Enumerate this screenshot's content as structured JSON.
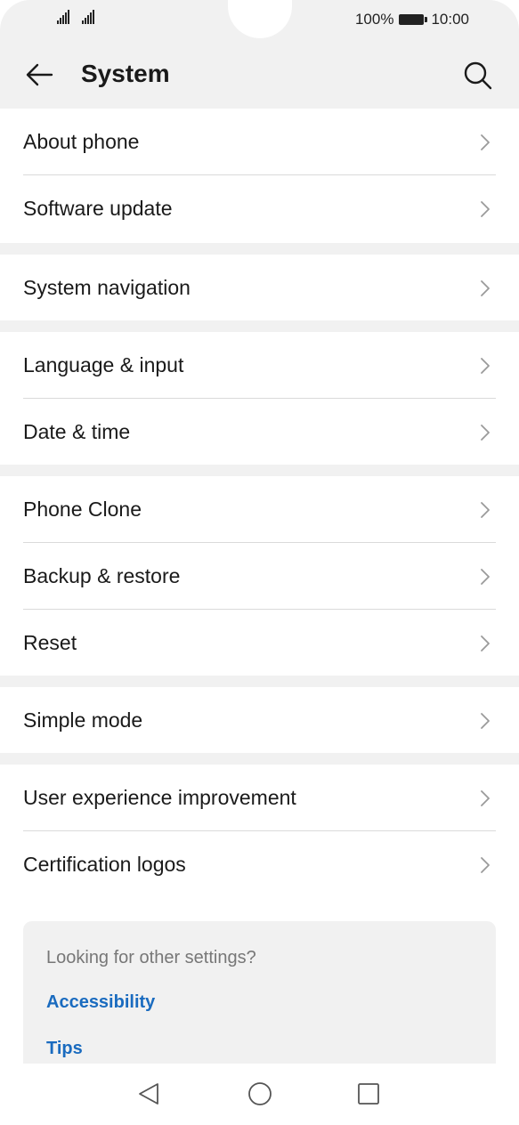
{
  "status_bar": {
    "battery_percent": "100%",
    "time": "10:00",
    "signal_icons": [
      "signal-icon",
      "signal-icon"
    ],
    "battery_icon": "battery-icon"
  },
  "header": {
    "title": "System",
    "back_icon": "arrow-left-icon",
    "search_icon": "search-icon"
  },
  "groups": [
    {
      "items": [
        {
          "label": "About phone"
        },
        {
          "label": "Software update"
        }
      ]
    },
    {
      "items": [
        {
          "label": "System navigation"
        }
      ]
    },
    {
      "items": [
        {
          "label": "Language & input"
        },
        {
          "label": "Date & time"
        }
      ]
    },
    {
      "items": [
        {
          "label": "Phone Clone"
        },
        {
          "label": "Backup & restore"
        },
        {
          "label": "Reset"
        }
      ]
    },
    {
      "items": [
        {
          "label": "Simple mode"
        }
      ]
    },
    {
      "items": [
        {
          "label": "User experience improvement"
        },
        {
          "label": "Certification logos"
        }
      ]
    }
  ],
  "suggestions": {
    "question": "Looking for other settings?",
    "links": [
      "Accessibility",
      "Tips"
    ],
    "link_color": "#1a6bbf"
  },
  "nav_bar": {
    "icons": [
      "back-triangle-icon",
      "home-circle-icon",
      "recents-square-icon"
    ]
  },
  "colors": {
    "background": "#ffffff",
    "section_gap": "#f1f1f1",
    "divider": "#dadada",
    "text": "#1a1a1a"
  }
}
